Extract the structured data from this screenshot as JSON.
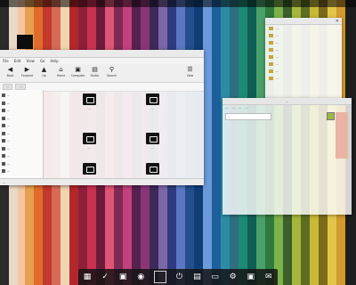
{
  "file_manager": {
    "menu": [
      "File",
      "Edit",
      "View",
      "Go",
      "Help"
    ],
    "toolbar": [
      {
        "icon": "back-icon",
        "glyph": "◀",
        "label": "Back"
      },
      {
        "icon": "forward-icon",
        "glyph": "▶",
        "label": "Forward"
      },
      {
        "icon": "up-icon",
        "glyph": "▲",
        "label": "Up"
      },
      {
        "icon": "home-icon",
        "glyph": "⌂",
        "label": "Home"
      },
      {
        "icon": "computer-icon",
        "glyph": "▣",
        "label": "Computer"
      },
      {
        "icon": "folder-icon",
        "glyph": "▤",
        "label": "Folder"
      },
      {
        "icon": "search-icon",
        "glyph": "⚲",
        "label": "Search"
      },
      {
        "icon": "view-icon",
        "glyph": "☰",
        "label": "View"
      }
    ],
    "path": [
      "...",
      "..."
    ],
    "sidebar": [
      "...",
      "...",
      "...",
      "...",
      "...",
      "...",
      "...",
      "...",
      "...",
      "...",
      "..."
    ],
    "files": [
      "...",
      "...",
      "...",
      "...",
      "...",
      "..."
    ],
    "status": "..."
  },
  "right_top_window": {
    "items": [
      "...",
      "...",
      "...",
      "...",
      "...",
      "...",
      "...",
      "..."
    ],
    "close": "✕"
  },
  "right_lower_window": {
    "title": "...",
    "menu": [
      "...",
      "...",
      "...",
      "..."
    ],
    "input_placeholder": "..."
  },
  "dock": [
    {
      "icon": "image-viewer-icon",
      "glyph": "▦"
    },
    {
      "icon": "checkmark-icon",
      "glyph": "✓"
    },
    {
      "icon": "screenshot-icon",
      "glyph": "▣"
    },
    {
      "icon": "camera-icon",
      "glyph": "◉"
    },
    {
      "icon": "blank-window-icon",
      "glyph": ""
    },
    {
      "icon": "power-icon",
      "glyph": "⏻"
    },
    {
      "icon": "folder-icon",
      "glyph": "▤"
    },
    {
      "icon": "drive-icon",
      "glyph": "▭"
    },
    {
      "icon": "settings-icon",
      "glyph": "⚙"
    },
    {
      "icon": "terminal-icon",
      "glyph": "▣"
    },
    {
      "icon": "chat-icon",
      "glyph": "✉"
    }
  ]
}
